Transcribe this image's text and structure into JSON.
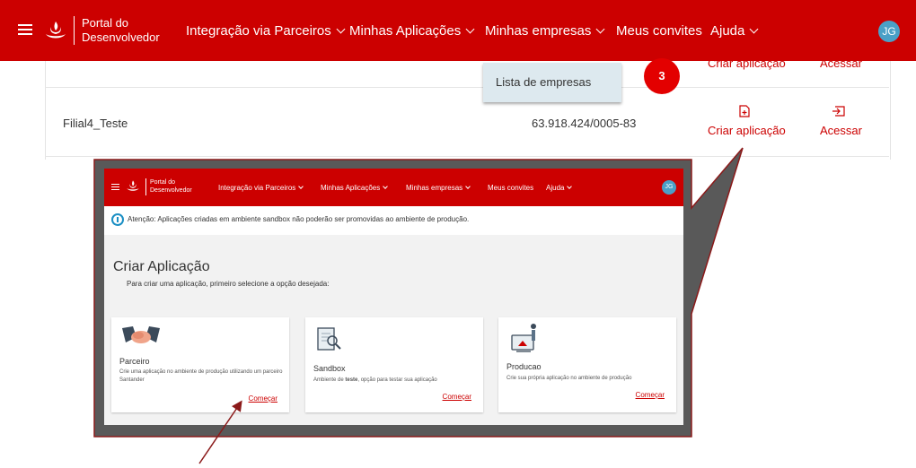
{
  "header": {
    "brand_line1": "Portal do",
    "brand_line2": "Desenvolvedor",
    "nav": [
      "Integração via Parceiros",
      "Minhas Aplicações",
      "Minhas empresas",
      "Meus convites",
      "Ajuda"
    ],
    "avatar": "JG"
  },
  "table": {
    "row1": {
      "action1": "Criar aplicação",
      "action2": "Acessar"
    },
    "row2": {
      "name": "Filial4_Teste",
      "cnpj": "63.918.424/0005-83",
      "action1": "Criar aplicação",
      "action2": "Acessar"
    }
  },
  "dropdown": {
    "item": "Lista de empresas"
  },
  "step_badge": "3",
  "zoom": {
    "header": {
      "brand_line1": "Portal do",
      "brand_line2": "Desenvolvedor",
      "nav": [
        "Integração via Parceiros",
        "Minhas Aplicações",
        "Minhas empresas",
        "Meus convites",
        "Ajuda"
      ],
      "avatar": "JG"
    },
    "alert": "Atenção: Aplicações criadas em ambiente sandbox não poderão ser promovidas ao ambiente de produção.",
    "title": "Criar Aplicação",
    "subtitle": "Para criar uma aplicação, primeiro selecione a opção desejada:",
    "cards": [
      {
        "title": "Parceiro",
        "desc": "Crie uma aplicação no ambiente de produção utilizando um parceiro Santander",
        "link": "Começar"
      },
      {
        "title": "Sandbox",
        "desc_pre": "Ambiente de ",
        "desc_bold": "teste",
        "desc_post": ", opção para testar sua aplicação",
        "link": "Começar"
      },
      {
        "title": "Producao",
        "desc": "Crie sua própria aplicação no ambiente de produção",
        "link": "Começar"
      }
    ]
  },
  "colors": {
    "brand_red": "#cc0000",
    "avatar_blue": "#4aa0c7",
    "callout_gray": "#555555",
    "dropdown_bg": "#dde9ef"
  }
}
